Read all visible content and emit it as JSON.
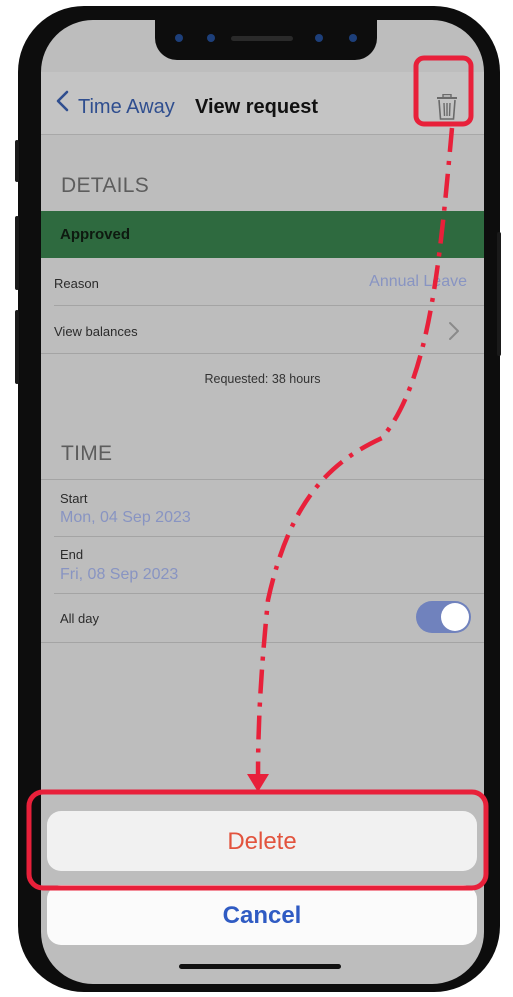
{
  "nav": {
    "back_label": "Time Away",
    "title": "View request"
  },
  "details": {
    "header": "DETAILS",
    "status": "Approved",
    "reason_label": "Reason",
    "reason_value": "Annual Leave",
    "balances_label": "View balances",
    "requested_note": "Requested: 38 hours"
  },
  "time": {
    "header": "TIME",
    "start_label": "Start",
    "start_value": "Mon, 04 Sep 2023",
    "end_label": "End",
    "end_value": "Fri, 08 Sep 2023",
    "allday_label": "All day",
    "allday_on": true
  },
  "sheet": {
    "delete_label": "Delete",
    "cancel_label": "Cancel"
  },
  "colors": {
    "approved": "#2e6a3f",
    "accent": "#2f4e8f",
    "delete": "#e2533d",
    "cancel": "#2f5bc3",
    "annotation": "#e8203a"
  },
  "icons": {
    "back": "chevron-left-icon",
    "trash": "trash-icon",
    "balances": "chevron-right-icon"
  }
}
